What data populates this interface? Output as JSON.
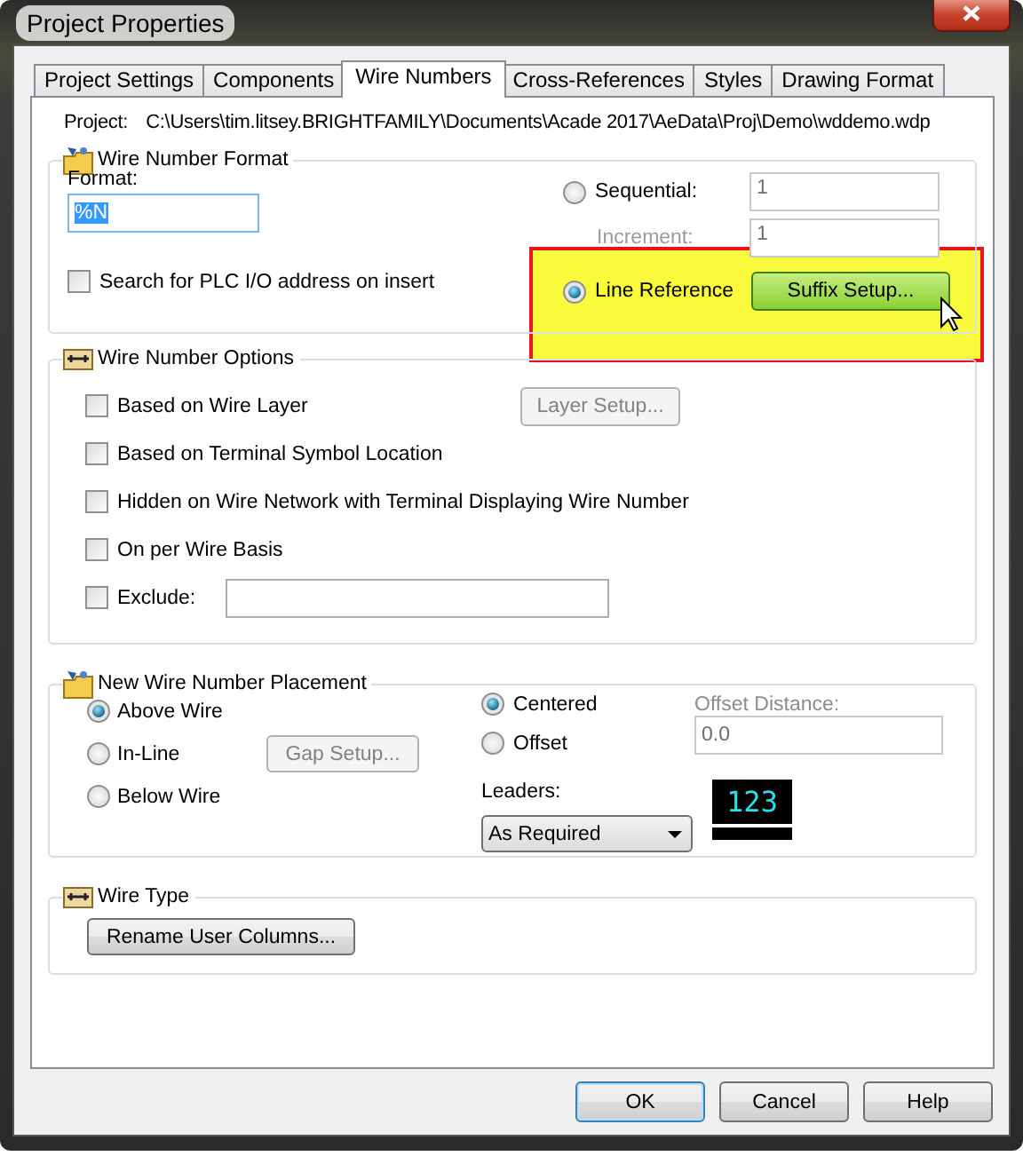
{
  "window": {
    "title": "Project Properties"
  },
  "tabs": [
    {
      "label": "Project Settings",
      "selected": false
    },
    {
      "label": "Components",
      "selected": false
    },
    {
      "label": "Wire Numbers",
      "selected": true
    },
    {
      "label": "Cross-References",
      "selected": false
    },
    {
      "label": "Styles",
      "selected": false
    },
    {
      "label": "Drawing Format",
      "selected": false
    }
  ],
  "project": {
    "label": "Project:",
    "path": "C:\\Users\\tim.litsey.BRIGHTFAMILY\\Documents\\Acade 2017\\AeData\\Proj\\Demo\\wddemo.wdp"
  },
  "wire_number_format": {
    "title": "Wire Number Format",
    "format_label": "Format:",
    "format_value": "%N",
    "format_value_selected": true,
    "search_plc": {
      "label": "Search for PLC I/O address on insert",
      "checked": false
    },
    "sequential": {
      "label": "Sequential:",
      "selected": false,
      "value": "1",
      "disabled": true
    },
    "increment": {
      "label": "Increment:",
      "value": "1",
      "disabled": true
    },
    "line_reference": {
      "label": "Line Reference",
      "selected": true,
      "button": "Suffix Setup...",
      "button_hovered": true,
      "highlighted": true
    }
  },
  "wire_number_options": {
    "title": "Wire Number Options",
    "items": [
      {
        "kind": "button",
        "label": "Based on Wire Layer",
        "checked": false,
        "button": "Layer Setup...",
        "disabled": true
      },
      {
        "kind": "plain",
        "label": "Based on Terminal Symbol Location",
        "checked": false
      },
      {
        "kind": "plain",
        "label": "Hidden on Wire Network with Terminal Displaying Wire Number",
        "checked": false
      },
      {
        "kind": "plain",
        "label": "On per Wire Basis",
        "checked": false
      },
      {
        "kind": "field",
        "label": "Exclude:",
        "checked": false
      }
    ]
  },
  "placement": {
    "title": "New Wire Number Placement",
    "positions": [
      {
        "label": "Above Wire",
        "selected": true
      },
      {
        "label": "In-Line",
        "selected": false,
        "button": "Gap Setup...",
        "disabled": true
      },
      {
        "label": "Below Wire",
        "selected": false
      }
    ],
    "alignment": [
      {
        "label": "Centered",
        "selected": true
      },
      {
        "label": "Offset",
        "selected": false
      }
    ],
    "offset_distance": {
      "label": "Offset Distance:",
      "value": "0.0",
      "disabled": true
    },
    "leaders": {
      "label": "Leaders:",
      "value": "As Required"
    },
    "preview": "123"
  },
  "wire_type": {
    "title": "Wire Type",
    "button": "Rename User Columns..."
  },
  "buttons": [
    {
      "label": "OK",
      "default": true
    },
    {
      "label": "Cancel",
      "default": false
    },
    {
      "label": "Help",
      "default": false
    }
  ]
}
